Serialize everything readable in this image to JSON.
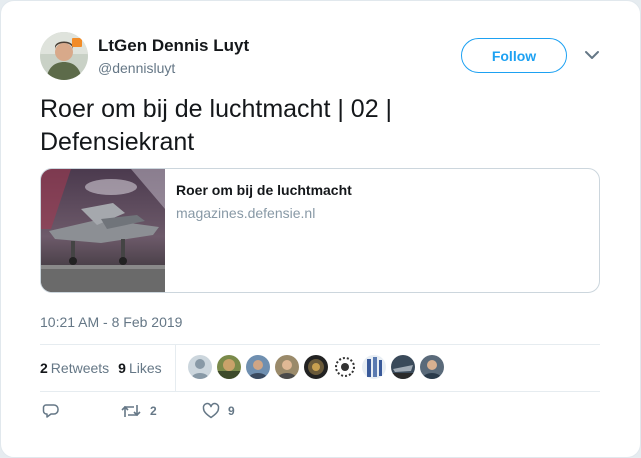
{
  "author": {
    "name": "LtGen Dennis Luyt",
    "handle": "@dennisluyt"
  },
  "follow_button": {
    "label": "Follow"
  },
  "tweet": {
    "text_line1": "Roer om bij de luchtmacht | 02 |",
    "text_line2": "Defensiekrant"
  },
  "link_card": {
    "title": "Roer om bij de luchtmacht",
    "domain": "magazines.defensie.nl"
  },
  "timestamp": "10:21 AM - 8 Feb 2019",
  "stats": {
    "retweets_count": "2",
    "retweets_label": "Retweets",
    "likes_count": "9",
    "likes_label": "Likes"
  },
  "actions": {
    "reply_icon": "reply-icon",
    "retweet_icon": "retweet-icon",
    "retweet_count": "2",
    "like_icon": "heart-icon",
    "like_count": "9"
  },
  "colors": {
    "accent": "#1da1f2",
    "secondary_text": "#657786",
    "primary_text": "#14171a"
  }
}
